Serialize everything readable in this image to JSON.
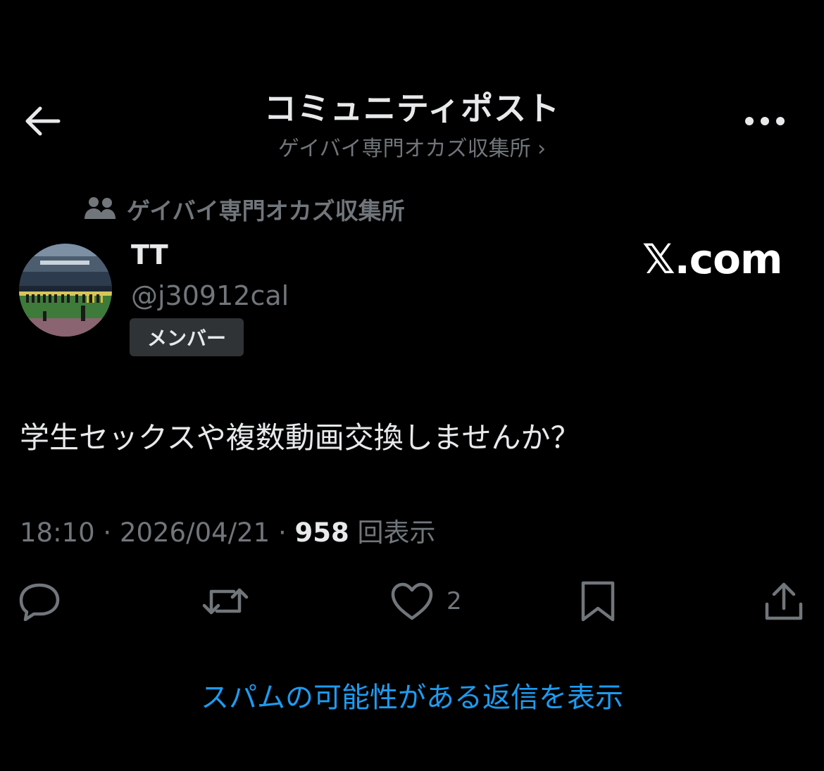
{
  "header": {
    "title": "コミュニティポスト",
    "subtitle": "ゲイバイ専門オカズ収集所 ›"
  },
  "community": {
    "name": "ゲイバイ専門オカズ収集所",
    "icon": "community-icon"
  },
  "author": {
    "display_name": "TT",
    "handle": "@j30912cal",
    "badge": "メンバー"
  },
  "watermark": "𝕏.com",
  "post": {
    "text": "学生セックスや複数動画交換しませんか？"
  },
  "meta": {
    "time": "18:10",
    "sep1": " · ",
    "date": "2026/04/21",
    "sep2": " · ",
    "views": "958",
    "views_label": " 回表示"
  },
  "actions": {
    "reply_icon": "reply-icon",
    "repost_icon": "repost-icon",
    "like_icon": "heart-icon",
    "like_count": "2",
    "bookmark_icon": "bookmark-icon",
    "share_icon": "share-icon"
  },
  "spam_link": "スパムの可能性がある返信を表示",
  "colors": {
    "background": "#000000",
    "text_primary": "#e7e9ea",
    "text_secondary": "#71767b",
    "accent": "#1d9bf0",
    "badge_bg": "#2f3336"
  }
}
